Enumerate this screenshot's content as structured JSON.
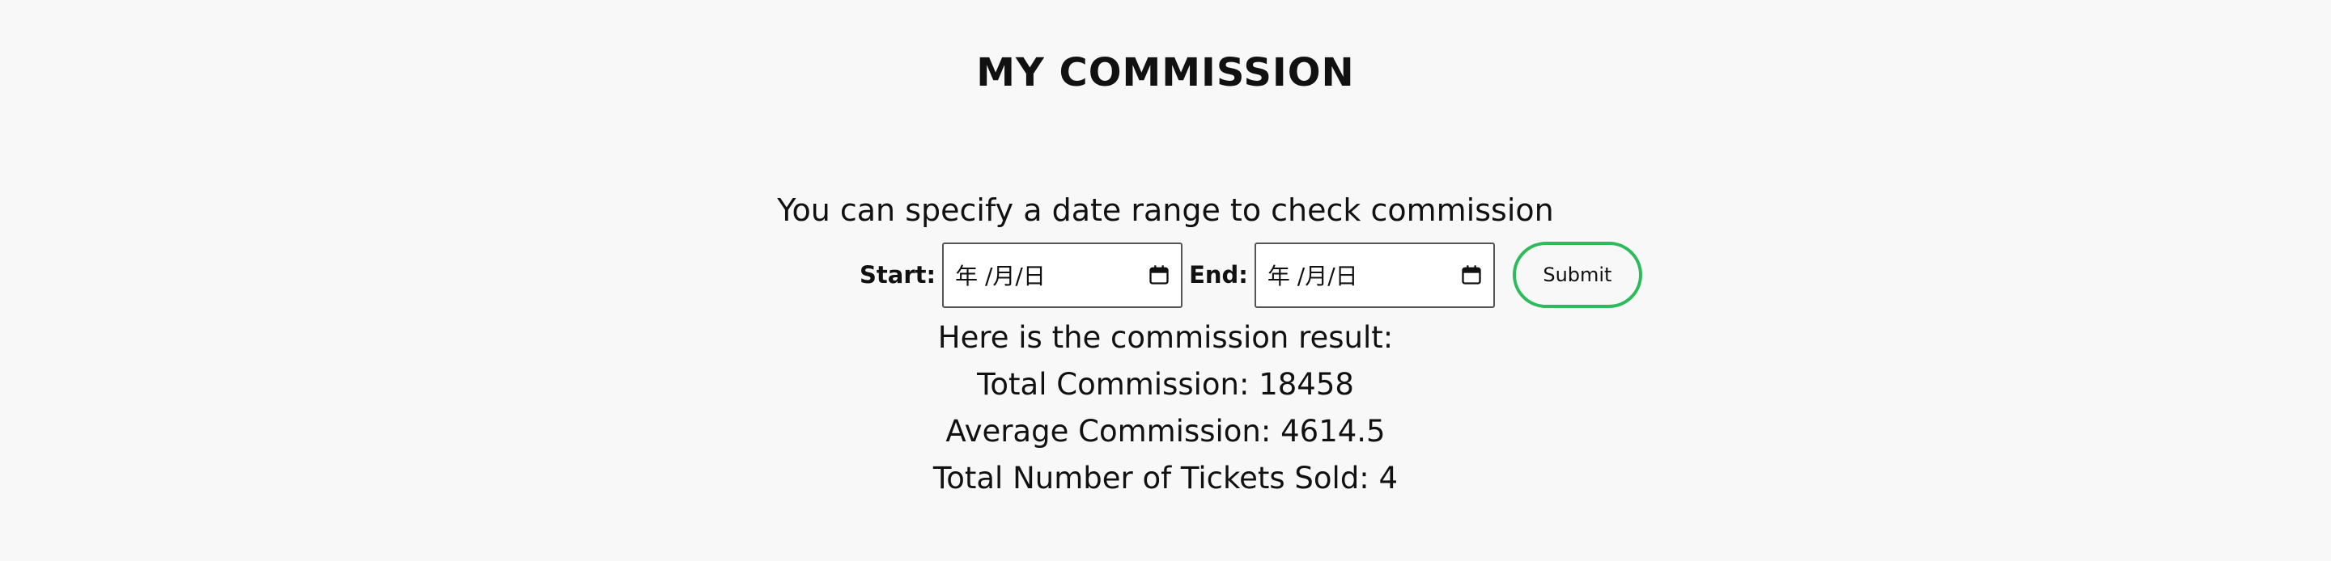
{
  "header": {
    "title": "MY COMMISSION"
  },
  "form": {
    "instruction": "You can specify a date range to check commission",
    "start_label": "Start:",
    "start_placeholder": "年 /月/日",
    "end_label": "End:",
    "end_placeholder": "年 /月/日",
    "calendar_icon": "calendar-icon",
    "submit_label": "Submit",
    "accent_color": "#2dbb5c"
  },
  "results": {
    "heading": "Here is the commission result:",
    "total_commission": "Total Commission: 18458",
    "average_commission": "Average Commission: 4614.5",
    "tickets_sold": "Total Number of Tickets Sold: 4"
  }
}
